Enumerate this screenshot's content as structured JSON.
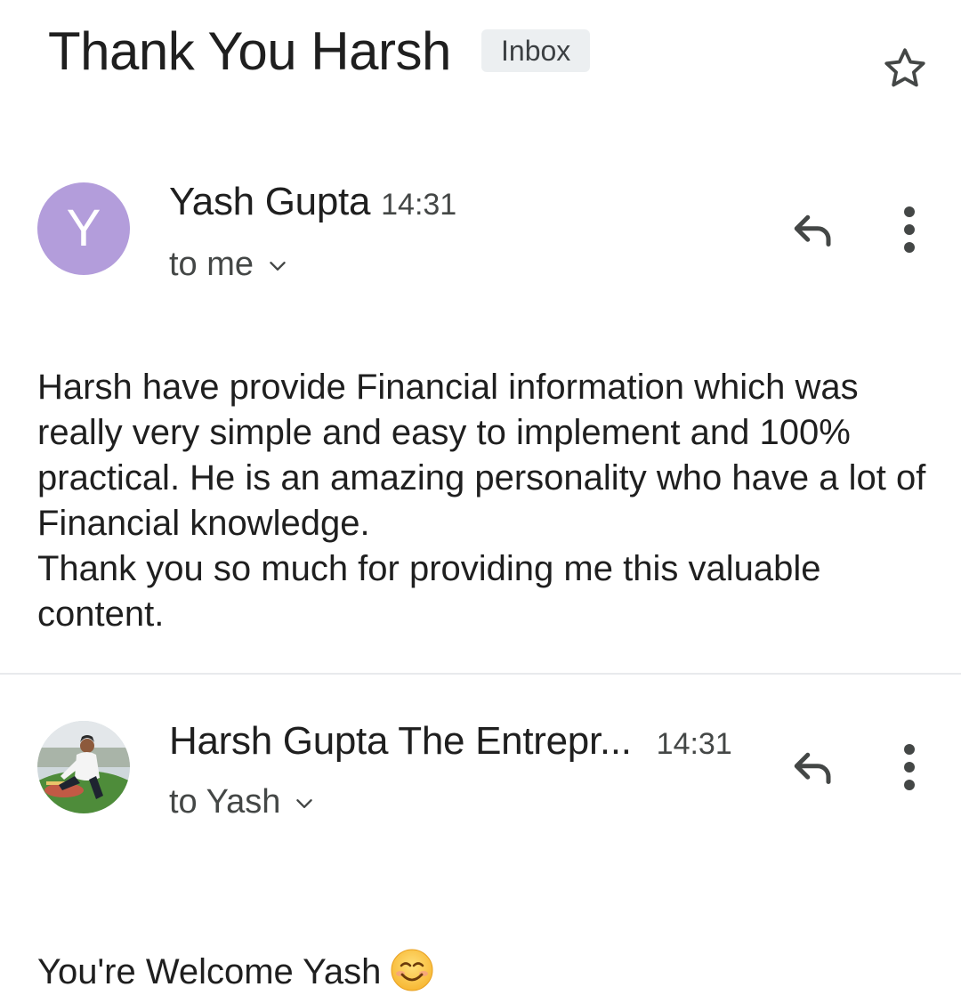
{
  "thread": {
    "subject": "Thank You Harsh",
    "label": "Inbox"
  },
  "messages": [
    {
      "avatar_letter": "Y",
      "avatar_color": "#b39ddb",
      "sender": "Yash Gupta",
      "time": "14:31",
      "recipient": "to me",
      "body": "Harsh have provide Financial information which was really very simple and easy to implement and 100% practical. He is an amazing personality who have a lot of Financial knowledge.\nThank you so much for providing me this valuable content."
    },
    {
      "avatar_icon": "profile-photo",
      "sender": "Harsh Gupta The Entrepr...",
      "time": "14:31",
      "recipient": "to Yash",
      "body": "You're Welcome Yash"
    }
  ],
  "icons": {
    "star": "star-outline-icon",
    "reply": "reply-icon",
    "more": "more-vert-icon",
    "expand": "chevron-down-icon",
    "emoji": "smiling-face-emoji"
  }
}
